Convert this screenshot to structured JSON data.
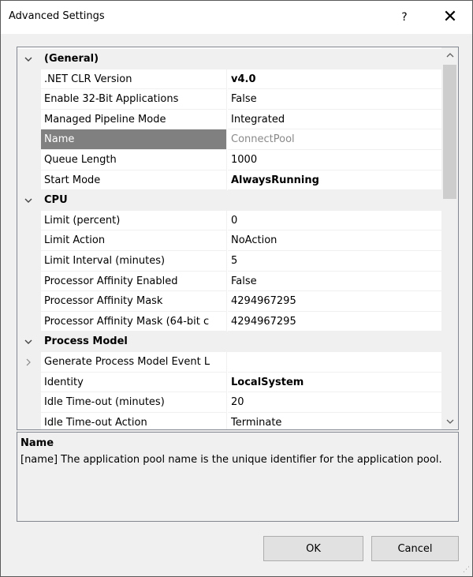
{
  "window": {
    "title": "Advanced Settings",
    "help_label": "?",
    "close_label": "✕"
  },
  "grid": {
    "rows": [
      {
        "type": "category",
        "expander": "chevron-down",
        "name": "(General)",
        "value": ""
      },
      {
        "type": "property",
        "name": ".NET CLR Version",
        "value": "v4.0",
        "bold": true
      },
      {
        "type": "property",
        "name": "Enable 32-Bit Applications",
        "value": "False"
      },
      {
        "type": "property",
        "name": "Managed Pipeline Mode",
        "value": "Integrated"
      },
      {
        "type": "property",
        "name": "Name",
        "value": "ConnectPool",
        "selected": true
      },
      {
        "type": "property",
        "name": "Queue Length",
        "value": "1000"
      },
      {
        "type": "property",
        "name": "Start Mode",
        "value": "AlwaysRunning",
        "bold": true
      },
      {
        "type": "category",
        "expander": "chevron-down",
        "name": "CPU",
        "value": ""
      },
      {
        "type": "property",
        "name": "Limit (percent)",
        "value": "0"
      },
      {
        "type": "property",
        "name": "Limit Action",
        "value": "NoAction"
      },
      {
        "type": "property",
        "name": "Limit Interval (minutes)",
        "value": "5"
      },
      {
        "type": "property",
        "name": "Processor Affinity Enabled",
        "value": "False"
      },
      {
        "type": "property",
        "name": "Processor Affinity Mask",
        "value": "4294967295"
      },
      {
        "type": "property",
        "name": "Processor Affinity Mask (64-bit c",
        "value": "4294967295"
      },
      {
        "type": "category",
        "expander": "chevron-down",
        "name": "Process Model",
        "value": ""
      },
      {
        "type": "property",
        "expander": "chevron-right",
        "name": "Generate Process Model Event L",
        "value": ""
      },
      {
        "type": "property",
        "name": "Identity",
        "value": "LocalSystem",
        "bold": true
      },
      {
        "type": "property",
        "name": "Idle Time-out (minutes)",
        "value": "20"
      },
      {
        "type": "property",
        "name": "Idle Time-out Action",
        "value": "Terminate"
      }
    ],
    "scroll_up": "^",
    "scroll_down": "v"
  },
  "description": {
    "title": "Name",
    "text": "[name] The application pool name is the unique identifier for the application pool."
  },
  "buttons": {
    "ok": "OK",
    "cancel": "Cancel"
  },
  "colors": {
    "selected_name_bg": "#808080",
    "category_bg": "#f0f0f0"
  }
}
